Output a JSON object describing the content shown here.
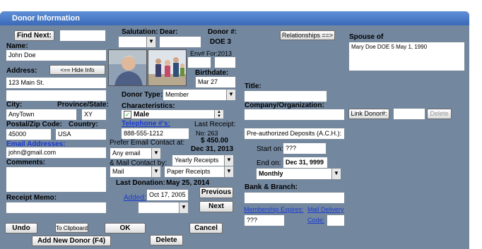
{
  "window_title": "Donor Information",
  "find_next_label": "Find Next:",
  "find_next_value": "",
  "name_label": "Name:",
  "name_value": "John Doe",
  "address_label": "Address:",
  "hide_info_label": "<== Hide Info",
  "address_line1": "123 Main St.",
  "address_line2": "",
  "city_label": "City:",
  "province_label": "Province/State:",
  "city_value": "AnyTown",
  "province_value": "XY",
  "postal_label": "Postal/Zip Code:",
  "country_label": "Country:",
  "postal_value": "45000",
  "country_value": "USA",
  "email_label": "Email Addresses:",
  "email_value": "john@gmail.com",
  "comments_label": "Comments:",
  "comments_value": "",
  "receipt_memo_label": "Receipt Memo:",
  "receipt_memo_value": "",
  "salutation_label": "Salutation:",
  "dear_label": "Dear:",
  "salutation_value": "",
  "dear_value": "",
  "donor_num_label": "Donor #:",
  "donor_num_value": "DOE  3",
  "env_label": "Env#",
  "for_label": "For:2013",
  "env_value": "",
  "for_value": "",
  "birthdate_label": "Birthdate:",
  "birthdate_value": "Mar 27",
  "donor_type_label": "Donor Type:",
  "donor_type_value": "Member",
  "characteristics_label": "Characteristics:",
  "characteristic_value": "Male",
  "telephone_label": "Telephone #'s:",
  "telephone_value": "888-555-1212",
  "last_receipt_label": "Last Receipt:",
  "last_receipt_no": "No: 263",
  "last_receipt_amount": "$ 450.00",
  "last_receipt_date": "Dec 31, 2013",
  "prefer_email_label": "Prefer Email Contact at:",
  "prefer_email_value": "Any email",
  "yearly_receipts_value": "Yearly Receipts",
  "mail_contact_label": "& Mail Contact by:",
  "mail_contact_value": "Mail",
  "paper_receipts_value": "Paper Receipts",
  "last_donation_label": "Last Donation:",
  "last_donation_value": "May 25, 2014",
  "added_label": "Added:",
  "added_value": "Oct 17, 2005",
  "added_select_value": "",
  "previous_label": "Previous",
  "next_label": "Next",
  "relationships_label": "Relationships ==>",
  "spouse_label": "Spouse of",
  "spouse_value": "Mary Doe  DOE  5  May 1, 1990",
  "title_label": "Title:",
  "title_value": "",
  "company_label": "Company/Organization:",
  "company_value": "",
  "link_donor_label": "Link Donor#:",
  "link_donor_value": "",
  "delete_small_label": "Delete",
  "preauth_value": "Pre-authorized Deposits (A.C.H.):",
  "start_on_label": "Start on:",
  "start_on_value": "???",
  "end_on_label": "End on:",
  "end_on_value": "Dec 31, 9999",
  "frequency_value": "Monthly",
  "bank_label": "Bank & Branch:",
  "bank_value": "",
  "membership_label": "Membership Expires:",
  "membership_value": "???",
  "mail_delivery_label": "Mail Delivery",
  "code_label": "Code:",
  "code_value": "",
  "undo_label": "Undo",
  "to_clipboard_label": "To Clipboard",
  "ok_label": "OK",
  "cancel_label": "Cancel",
  "add_new_donor_label": "Add New Donor (F4)",
  "delete_label": "Delete",
  "dropdown_glyph": "▼",
  "checkbox_glyph": "✓"
}
